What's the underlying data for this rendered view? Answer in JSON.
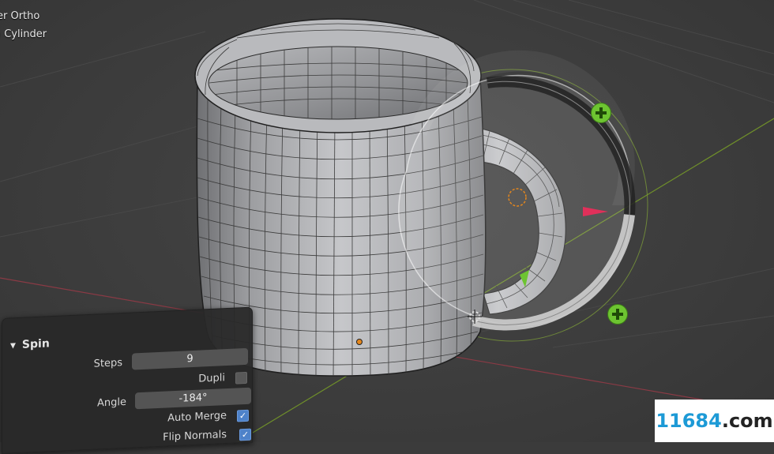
{
  "viewport": {
    "view_label": "er Ortho",
    "object_label": ") Cylinder"
  },
  "operator_panel": {
    "title": "Spin",
    "steps_label": "Steps",
    "steps_value": "9",
    "dupli_label": "Dupli",
    "dupli_checked": false,
    "angle_label": "Angle",
    "angle_value": "-184°",
    "auto_merge_label": "Auto Merge",
    "auto_merge_checked": true,
    "flip_normals_label": "Flip Normals",
    "flip_normals_checked": true
  },
  "watermark": {
    "digits": "11684",
    "domain": ".com"
  },
  "colors": {
    "viewport_bg": "#3c3c3c",
    "x_axis": "#8a3a45",
    "y_axis": "#6f8f2a",
    "gizmo_plus": "#6dc431",
    "checkbox_on": "#4e82c9",
    "object_origin": "#e5871d"
  },
  "icons": {
    "panel_collapse": "triangle-down-icon",
    "gizmo_add": "plus-circle-icon",
    "cursor": "3d-cursor-icon"
  }
}
